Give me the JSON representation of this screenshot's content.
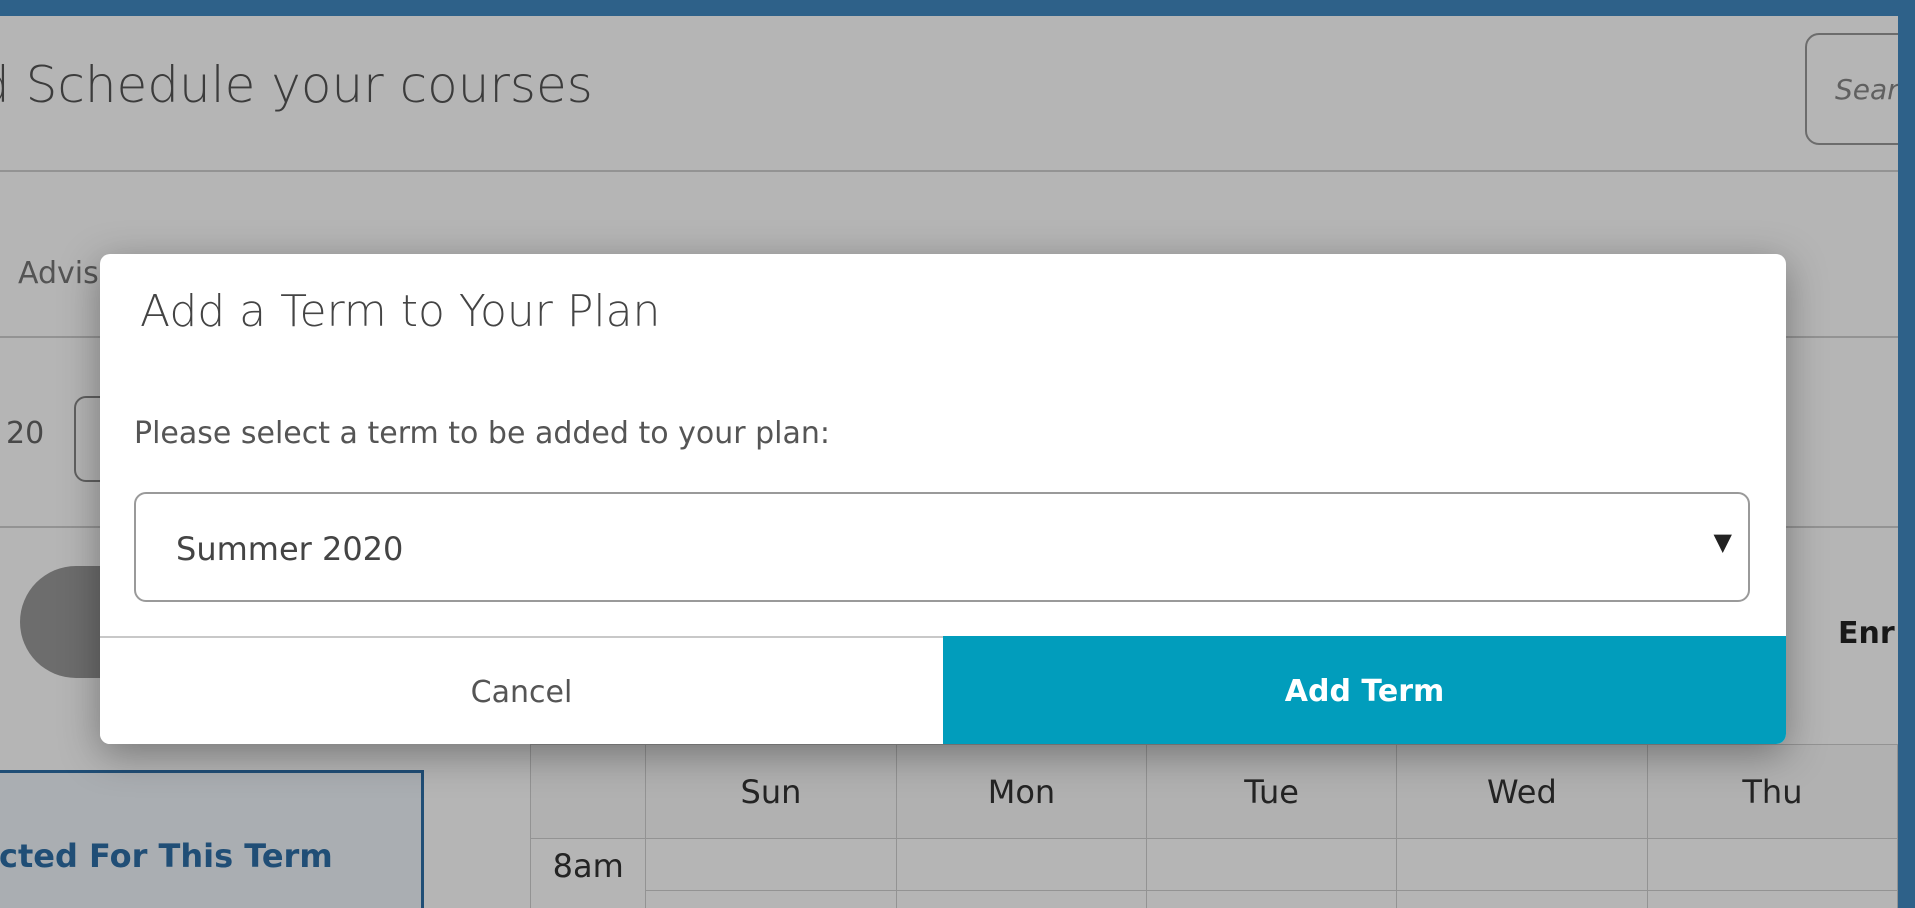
{
  "page": {
    "title": "d Schedule your courses",
    "search_placeholder": "Sear",
    "advisor_tab": "Advis",
    "term_prefix": "20",
    "enrolled_label": "Enr",
    "selected_panel_label": "cted For This Term"
  },
  "calendar": {
    "days": [
      "Sun",
      "Mon",
      "Tue",
      "Wed",
      "Thu"
    ],
    "first_time": "8am"
  },
  "modal": {
    "title": "Add a Term to Your Plan",
    "prompt": "Please select a term to be added to your plan:",
    "selected_term": "Summer 2020",
    "cancel_label": "Cancel",
    "add_label": "Add Term"
  },
  "colors": {
    "frame": "#2e6189",
    "primary_button": "#019dbc",
    "panel_accent": "#2e6fa7"
  }
}
